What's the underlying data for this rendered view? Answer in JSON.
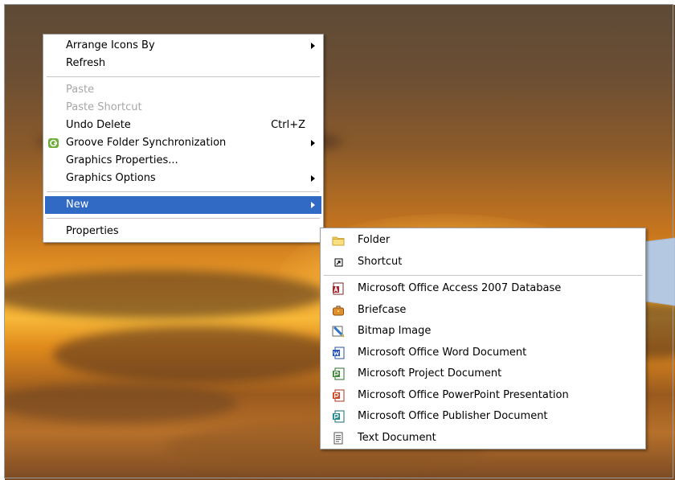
{
  "context_menu": {
    "items": [
      {
        "label": "Arrange Icons By",
        "has_submenu": true
      },
      {
        "label": "Refresh"
      },
      {
        "label": "Paste",
        "disabled": true
      },
      {
        "label": "Paste Shortcut",
        "disabled": true
      },
      {
        "label": "Undo Delete",
        "shortcut": "Ctrl+Z"
      },
      {
        "label": "Groove Folder Synchronization",
        "has_submenu": true,
        "icon": "groove-icon"
      },
      {
        "label": "Graphics Properties..."
      },
      {
        "label": "Graphics Options",
        "has_submenu": true
      },
      {
        "label": "New",
        "has_submenu": true,
        "selected": true
      },
      {
        "label": "Properties"
      }
    ]
  },
  "new_submenu": {
    "items": [
      {
        "label": "Folder",
        "icon": "folder-icon"
      },
      {
        "label": "Shortcut",
        "icon": "shortcut-icon"
      },
      {
        "label": "Microsoft Office Access 2007 Database",
        "icon": "access-icon"
      },
      {
        "label": "Briefcase",
        "icon": "briefcase-icon"
      },
      {
        "label": "Bitmap Image",
        "icon": "bitmap-icon"
      },
      {
        "label": "Microsoft Office Word Document",
        "icon": "word-icon"
      },
      {
        "label": "Microsoft Project Document",
        "icon": "project-icon"
      },
      {
        "label": "Microsoft Office PowerPoint Presentation",
        "icon": "powerpoint-icon"
      },
      {
        "label": "Microsoft Office Publisher Document",
        "icon": "publisher-icon"
      },
      {
        "label": "Text Document",
        "icon": "text-document-icon"
      }
    ]
  },
  "colors": {
    "selection": "#316ac5",
    "callout": "#b4c8e2",
    "disabled_text": "#a7a7a7"
  }
}
